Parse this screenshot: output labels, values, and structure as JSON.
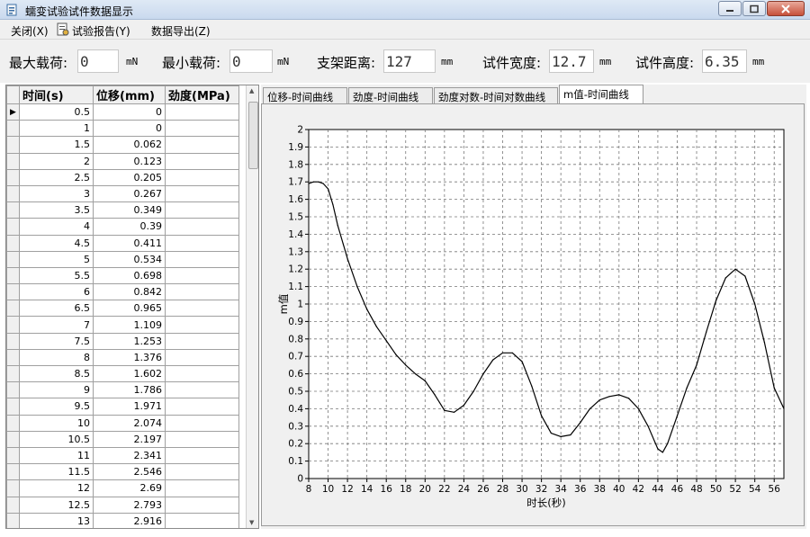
{
  "window": {
    "title": "蠕变试验试件数据显示",
    "icons": {
      "app": "document-icon",
      "minimize": "minimize-icon",
      "maximize": "maximize-icon",
      "close": "close-icon"
    }
  },
  "menu": {
    "close": "关闭(X)",
    "report": "试验报告(Y)",
    "export": "数据导出(Z)",
    "report_icon": "report-icon"
  },
  "params": {
    "max_load_label": "最大载荷:",
    "max_load": "0",
    "max_load_unit": "mN",
    "min_load_label": "最小载荷:",
    "min_load": "0",
    "min_load_unit": "mN",
    "span_label": "支架距离:",
    "span": "127",
    "span_unit": "mm",
    "width_label": "试件宽度:",
    "width": "12.7",
    "width_unit": "mm",
    "height_label": "试件高度:",
    "height": "6.35",
    "height_unit": "mm"
  },
  "table": {
    "columns": [
      "时间(s)",
      "位移(mm)",
      "劲度(MPa)"
    ],
    "rows": [
      [
        "0.5",
        "0",
        ""
      ],
      [
        "1",
        "0",
        ""
      ],
      [
        "1.5",
        "0.062",
        ""
      ],
      [
        "2",
        "0.123",
        ""
      ],
      [
        "2.5",
        "0.205",
        ""
      ],
      [
        "3",
        "0.267",
        ""
      ],
      [
        "3.5",
        "0.349",
        ""
      ],
      [
        "4",
        "0.39",
        ""
      ],
      [
        "4.5",
        "0.411",
        ""
      ],
      [
        "5",
        "0.534",
        ""
      ],
      [
        "5.5",
        "0.698",
        ""
      ],
      [
        "6",
        "0.842",
        ""
      ],
      [
        "6.5",
        "0.965",
        ""
      ],
      [
        "7",
        "1.109",
        ""
      ],
      [
        "7.5",
        "1.253",
        ""
      ],
      [
        "8",
        "1.376",
        ""
      ],
      [
        "8.5",
        "1.602",
        ""
      ],
      [
        "9",
        "1.786",
        ""
      ],
      [
        "9.5",
        "1.971",
        ""
      ],
      [
        "10",
        "2.074",
        ""
      ],
      [
        "10.5",
        "2.197",
        ""
      ],
      [
        "11",
        "2.341",
        ""
      ],
      [
        "11.5",
        "2.546",
        ""
      ],
      [
        "12",
        "2.69",
        ""
      ],
      [
        "12.5",
        "2.793",
        ""
      ],
      [
        "13",
        "2.916",
        ""
      ]
    ],
    "current_row_marker": "▶"
  },
  "tabs": [
    {
      "label": "位移-时间曲线",
      "active": false
    },
    {
      "label": "劲度-时间曲线",
      "active": false
    },
    {
      "label": "劲度对数-时间对数曲线",
      "active": false
    },
    {
      "label": "m值-时间曲线",
      "active": true
    }
  ],
  "chart_data": {
    "type": "line",
    "title": "",
    "xlabel": "时长(秒)",
    "ylabel": "m值",
    "xlim": [
      8,
      57
    ],
    "ylim": [
      0,
      2
    ],
    "xticks": [
      "8",
      "10",
      "12",
      "14",
      "16",
      "18",
      "20",
      "22",
      "24",
      "26",
      "28",
      "30",
      "32",
      "34",
      "36",
      "38",
      "40",
      "42",
      "44",
      "46",
      "48",
      "50",
      "52",
      "54",
      "56"
    ],
    "yticks": [
      "0",
      "0.1",
      "0.2",
      "0.3",
      "0.4",
      "0.5",
      "0.6",
      "0.7",
      "0.8",
      "0.9",
      "1",
      "1.1",
      "1.2",
      "1.3",
      "1.4",
      "1.5",
      "1.6",
      "1.7",
      "1.8",
      "1.9",
      "2"
    ],
    "grid": true,
    "line_color": "#000000",
    "series": [
      {
        "x": [
          8,
          8.5,
          9,
          9.5,
          10,
          10.5,
          11,
          12,
          13,
          14,
          15,
          16,
          17,
          18,
          19,
          20,
          21,
          22,
          23,
          24,
          25,
          26,
          27,
          28,
          29,
          30,
          31,
          32,
          33,
          34,
          35,
          36,
          37,
          38,
          39,
          40,
          41,
          42,
          43,
          44,
          44.5,
          45,
          46,
          47,
          48,
          49,
          50,
          51,
          52,
          53,
          54,
          55,
          56,
          57
        ],
        "y": [
          1.69,
          1.7,
          1.7,
          1.69,
          1.66,
          1.57,
          1.45,
          1.26,
          1.1,
          0.97,
          0.87,
          0.79,
          0.71,
          0.65,
          0.6,
          0.56,
          0.48,
          0.39,
          0.38,
          0.42,
          0.5,
          0.6,
          0.68,
          0.72,
          0.72,
          0.67,
          0.53,
          0.36,
          0.26,
          0.24,
          0.25,
          0.32,
          0.4,
          0.45,
          0.47,
          0.48,
          0.46,
          0.4,
          0.3,
          0.17,
          0.15,
          0.2,
          0.36,
          0.52,
          0.65,
          0.84,
          1.02,
          1.15,
          1.2,
          1.16,
          1.0,
          0.78,
          0.52,
          0.4
        ]
      }
    ]
  }
}
